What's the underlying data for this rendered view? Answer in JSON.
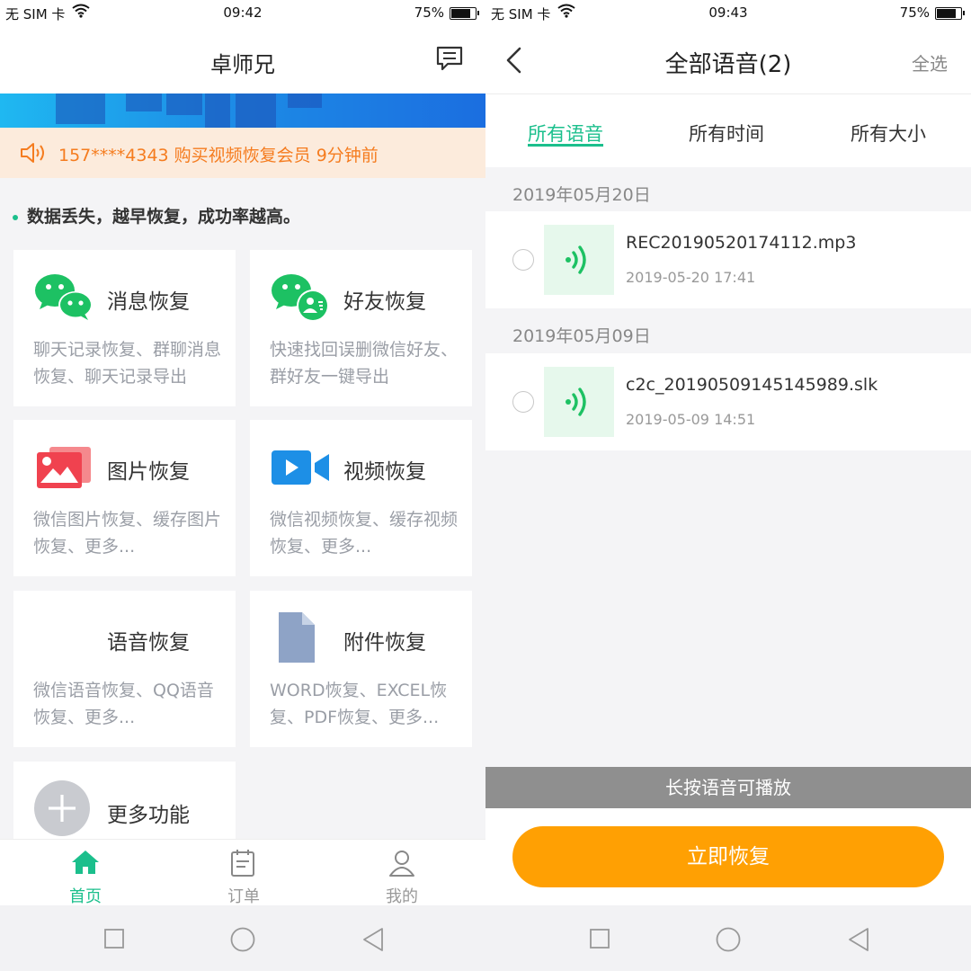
{
  "left": {
    "status_bar": {
      "carrier": "无 SIM 卡",
      "time": "09:42",
      "battery": "75%"
    },
    "header": {
      "title": "卓师兄"
    },
    "notice": {
      "text": "157****4343 购买视频恢复会员  9分钟前"
    },
    "tip": "数据丢失，越早恢复，成功率越高。",
    "cards": [
      {
        "title": "消息恢复",
        "desc": "聊天记录恢复、群聊消息恢复、聊天记录导出",
        "icon": "wechat-chat-icon"
      },
      {
        "title": "好友恢复",
        "desc": "快速找回误删微信好友、群好友一键导出",
        "icon": "wechat-contact-icon"
      },
      {
        "title": "图片恢复",
        "desc": "微信图片恢复、缓存图片恢复、更多...",
        "icon": "photo-icon"
      },
      {
        "title": "视频恢复",
        "desc": "微信视频恢复、缓存视频恢复、更多...",
        "icon": "video-camera-icon"
      },
      {
        "title": "语音恢复",
        "desc": "微信语音恢复、QQ语音恢复、更多...",
        "icon": "voice-wave-icon"
      },
      {
        "title": "附件恢复",
        "desc": "WORD恢复、EXCEL恢复、PDF恢复、更多...",
        "icon": "file-icon"
      },
      {
        "title": "更多功能",
        "desc": "",
        "icon": "plus-circle-icon"
      }
    ],
    "tabs": [
      {
        "label": "首页",
        "icon": "home-icon",
        "active": true
      },
      {
        "label": "订单",
        "icon": "order-icon",
        "active": false
      },
      {
        "label": "我的",
        "icon": "user-icon",
        "active": false
      }
    ]
  },
  "right": {
    "status_bar": {
      "carrier": "无 SIM 卡",
      "time": "09:43",
      "battery": "75%"
    },
    "header": {
      "title": "全部语音(2)",
      "select_all": "全选"
    },
    "filters": [
      {
        "label": "所有语音",
        "active": true
      },
      {
        "label": "所有时间",
        "active": false
      },
      {
        "label": "所有大小",
        "active": false
      }
    ],
    "groups": [
      {
        "date": "2019年05月20日",
        "files": [
          {
            "name": "REC20190520174112.mp3",
            "time": "2019-05-20 17:41"
          }
        ]
      },
      {
        "date": "2019年05月09日",
        "files": [
          {
            "name": "c2c_20190509145145989.slk",
            "time": "2019-05-09 14:51"
          }
        ]
      }
    ],
    "hint": "长按语音可播放",
    "recover_button": "立即恢复"
  },
  "colors": {
    "accent": "#1bbf8c",
    "orange": "#ffa003",
    "notice_text": "#f57c1f"
  },
  "battery_level": 0.75
}
